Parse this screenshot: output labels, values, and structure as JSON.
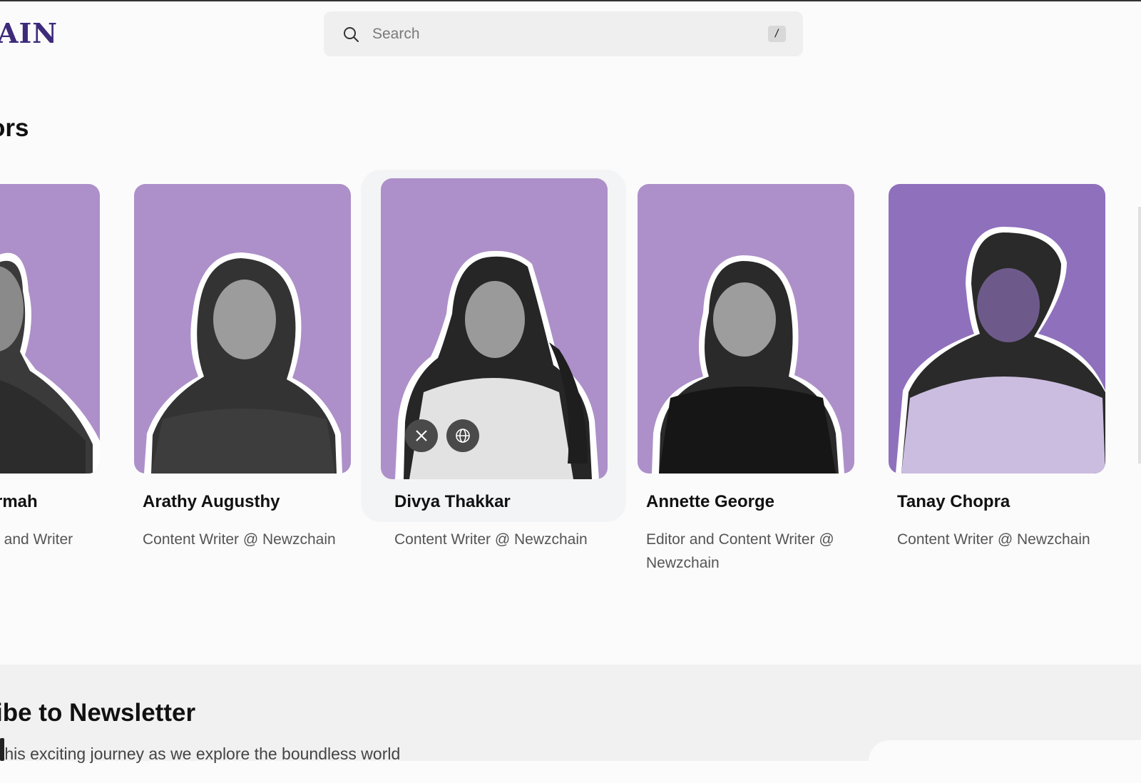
{
  "header": {
    "logo_text": "AIN",
    "search_placeholder": "Search",
    "search_shortcut": "/"
  },
  "section": {
    "title": "ors"
  },
  "authors": [
    {
      "name": "rmah",
      "role": "t and Writer"
    },
    {
      "name": "Arathy Augusthy",
      "role": "Content Writer @ Newzchain"
    },
    {
      "name": "Divya Thakkar",
      "role": "Content Writer @ Newzchain"
    },
    {
      "name": "Annette George",
      "role": "Editor and Content Writer @ Newzchain"
    },
    {
      "name": "Tanay Chopra",
      "role": "Content Writer @ Newzchain"
    }
  ],
  "featured_socials": [
    "x-icon",
    "globe-icon"
  ],
  "newsletter": {
    "title": "ibe to Newsletter",
    "text": "this exciting journey as we explore the boundless world"
  },
  "colors": {
    "accent": "#3d2a7a",
    "card_bg": "#ad90c9",
    "card_bg_dark": "#8f70bd"
  }
}
